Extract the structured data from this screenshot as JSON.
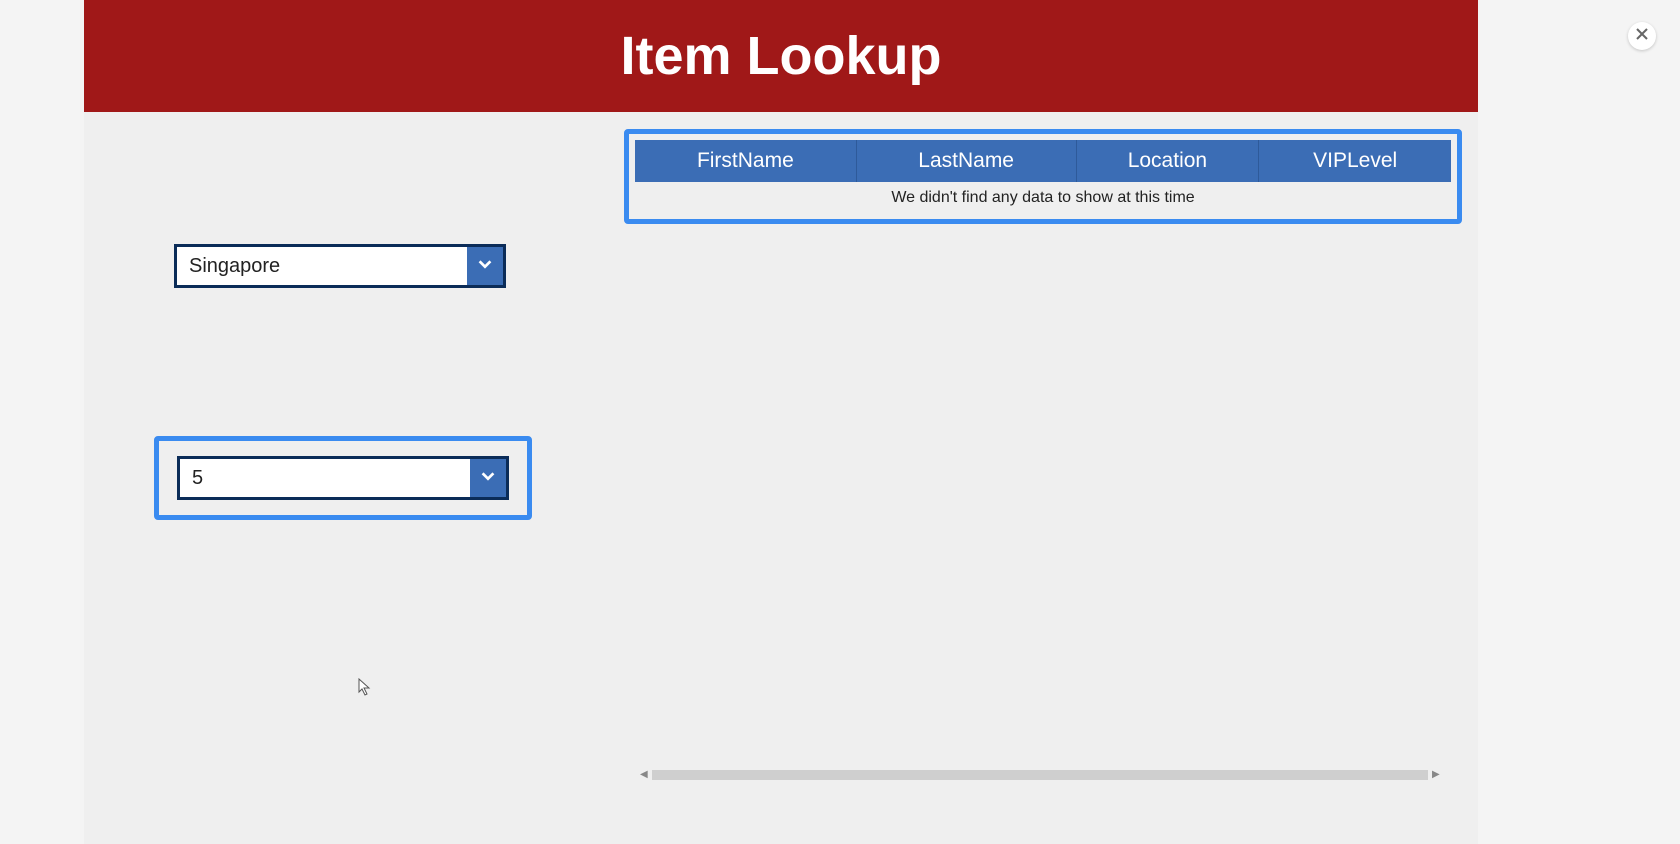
{
  "header": {
    "title": "Item Lookup"
  },
  "table": {
    "columns": [
      "FirstName",
      "LastName",
      "Location",
      "VIPLevel"
    ],
    "empty_message": "We didn't find any data to show at this time"
  },
  "filters": {
    "location": {
      "selected": "Singapore"
    },
    "level": {
      "selected": "5"
    }
  }
}
